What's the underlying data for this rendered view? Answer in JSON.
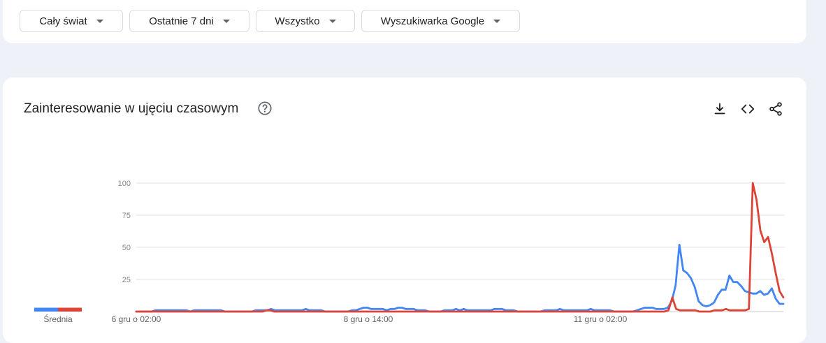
{
  "filters": [
    {
      "label": "Cały świat"
    },
    {
      "label": "Ostatnie 7 dni"
    },
    {
      "label": "Wszystko"
    },
    {
      "label": "Wyszukiwarka Google"
    }
  ],
  "card": {
    "title": "Zainteresowanie w ujęciu czasowym",
    "help_icon": "help-circle-icon",
    "actions": [
      "download-icon",
      "embed-code-icon",
      "share-icon"
    ]
  },
  "colors": {
    "series_blue": "#4285f4",
    "series_red": "#db4437",
    "grid": "#e0e0e0"
  },
  "chart_data": {
    "type": "line",
    "ylim": [
      0,
      100
    ],
    "yticks": [
      "25",
      "50",
      "75",
      "100"
    ],
    "x_tick_labels": [
      "6 gru o 02:00",
      "8 gru o 14:00",
      "11 gru o 02:00"
    ],
    "average_label": "Średnia",
    "averages": [
      3,
      3
    ],
    "series": [
      {
        "color": "#4285f4",
        "values": [
          0,
          0,
          0,
          0,
          0,
          1,
          1,
          1,
          1,
          1,
          1,
          1,
          1,
          1,
          0,
          1,
          1,
          1,
          1,
          1,
          1,
          1,
          1,
          0,
          0,
          0,
          0,
          0,
          0,
          0,
          0,
          1,
          1,
          1,
          1,
          2,
          1,
          1,
          1,
          1,
          1,
          1,
          1,
          1,
          2,
          1,
          1,
          1,
          1,
          0,
          0,
          0,
          0,
          0,
          0,
          0,
          1,
          1,
          2,
          3,
          3,
          2,
          2,
          2,
          2,
          1,
          2,
          2,
          3,
          3,
          2,
          2,
          2,
          1,
          1,
          1,
          0,
          0,
          0,
          0,
          1,
          1,
          1,
          2,
          1,
          2,
          1,
          1,
          1,
          1,
          1,
          1,
          1,
          2,
          2,
          2,
          1,
          1,
          1,
          0,
          0,
          0,
          0,
          0,
          0,
          0,
          1,
          1,
          1,
          1,
          2,
          1,
          1,
          1,
          1,
          1,
          1,
          1,
          2,
          1,
          1,
          1,
          1,
          1,
          0,
          0,
          0,
          0,
          0,
          0,
          1,
          2,
          3,
          3,
          3,
          2,
          2,
          2,
          3,
          8,
          20,
          52,
          32,
          30,
          26,
          19,
          8,
          5,
          4,
          5,
          7,
          13,
          17,
          17,
          28,
          23,
          23,
          20,
          16,
          15,
          14,
          14,
          16,
          13,
          14,
          18,
          10,
          6,
          6
        ]
      },
      {
        "color": "#db4437",
        "values": [
          0,
          0,
          0,
          0,
          0,
          0,
          0,
          0,
          0,
          0,
          0,
          0,
          0,
          0,
          0,
          0,
          0,
          0,
          0,
          0,
          0,
          0,
          0,
          0,
          0,
          0,
          0,
          0,
          0,
          0,
          0,
          0,
          0,
          0,
          1,
          1,
          0,
          0,
          0,
          0,
          0,
          0,
          0,
          0,
          0,
          0,
          0,
          0,
          0,
          0,
          0,
          0,
          0,
          0,
          0,
          0,
          0,
          0,
          0,
          0,
          0,
          0,
          0,
          0,
          0,
          0,
          0,
          0,
          0,
          0,
          0,
          0,
          0,
          0,
          0,
          0,
          0,
          0,
          0,
          0,
          0,
          0,
          0,
          0,
          0,
          0,
          0,
          0,
          0,
          0,
          0,
          0,
          0,
          0,
          0,
          0,
          0,
          0,
          0,
          0,
          0,
          0,
          0,
          0,
          0,
          0,
          0,
          0,
          0,
          0,
          0,
          0,
          0,
          0,
          0,
          0,
          0,
          0,
          0,
          0,
          0,
          0,
          0,
          0,
          0,
          0,
          0,
          0,
          0,
          0,
          0,
          0,
          0,
          0,
          0,
          0,
          0,
          0,
          0,
          1,
          11,
          2,
          1,
          1,
          1,
          1,
          1,
          0,
          0,
          0,
          0,
          1,
          1,
          1,
          2,
          1,
          1,
          1,
          1,
          1,
          2,
          100,
          87,
          63,
          54,
          58,
          45,
          30,
          16,
          11
        ]
      }
    ]
  }
}
